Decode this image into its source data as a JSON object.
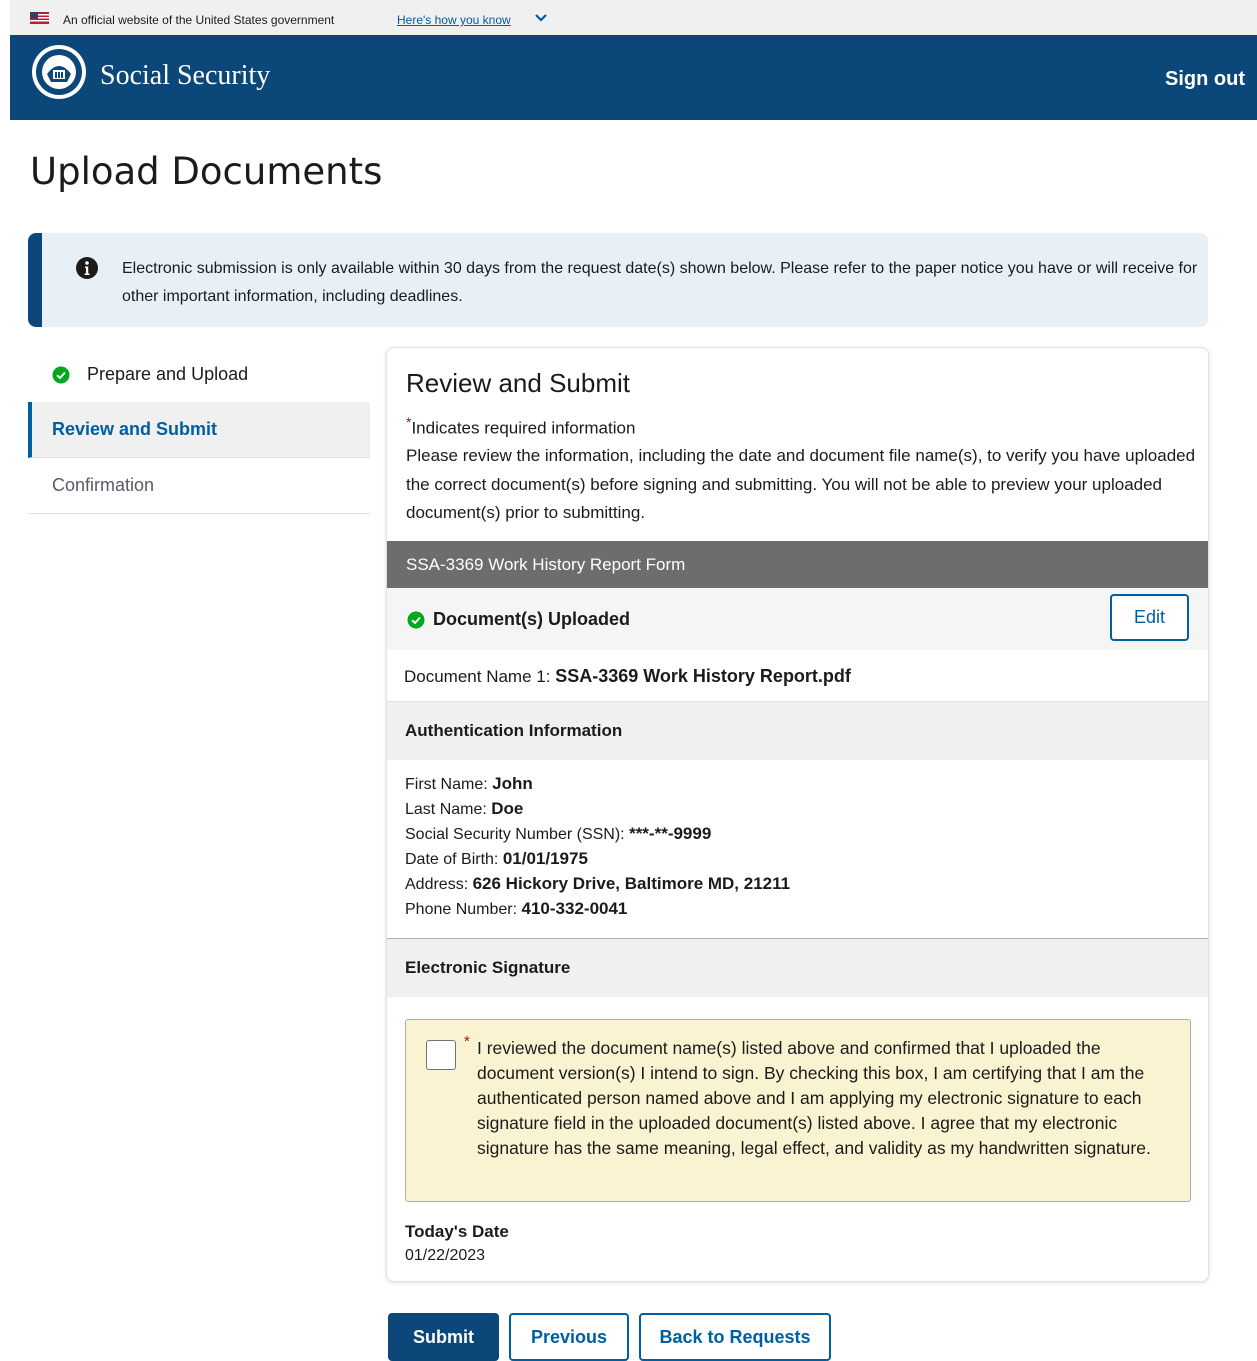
{
  "gov_banner": {
    "text": "An official website of the United States government",
    "link": "Here's how you know"
  },
  "header": {
    "brand": "Social Security",
    "sign_out": "Sign out"
  },
  "page": {
    "title": "Upload Documents"
  },
  "alert": {
    "message": "Electronic submission is only available within 30 days from the request date(s) shown below. Please refer to the paper notice you have or will receive for other important information, including deadlines."
  },
  "sidenav": {
    "items": [
      {
        "label": "Prepare and Upload",
        "status": "complete"
      },
      {
        "label": "Review and Submit",
        "status": "active"
      },
      {
        "label": "Confirmation",
        "status": "pending"
      }
    ]
  },
  "review": {
    "title": "Review and Submit",
    "required_note": "Indicates required information",
    "instructions": "Please review the information, including the date and document file name(s), to verify you have uploaded the correct document(s) before signing and submitting. You will not be able to preview your uploaded document(s) prior to submitting.",
    "form_name": "SSA-3369 Work History Report Form",
    "uploaded_status": "Document(s) Uploaded",
    "edit_label": "Edit",
    "document_name_label": "Document Name 1:",
    "document_name_value": "SSA-3369 Work History Report.pdf",
    "auth_heading": "Authentication Information",
    "auth_fields": [
      {
        "label": "First Name:",
        "value": "John"
      },
      {
        "label": "Last Name:",
        "value": "Doe"
      },
      {
        "label": "Social Security Number (SSN):",
        "value": "***-**-9999"
      },
      {
        "label": "Date of Birth:",
        "value": "01/01/1975"
      },
      {
        "label": "Address:",
        "value": "626 Hickory Drive, Baltimore MD, 21211"
      },
      {
        "label": "Phone Number:",
        "value": "410-332-0041"
      }
    ],
    "signature_heading": "Electronic Signature",
    "consent_text": "I reviewed the document name(s) listed above and confirmed that I uploaded the document version(s) I intend to sign. By checking this box, I am certifying that I am the authenticated person named above and I am applying my electronic signature to each signature field in the uploaded document(s) listed above. I agree that my electronic signature has the same meaning, legal effect, and validity as my handwritten signature.",
    "consent_checked": false,
    "date_label": "Today's Date",
    "date_value": "01/22/2023"
  },
  "actions": {
    "submit": "Submit",
    "previous": "Previous",
    "back": "Back to Requests"
  },
  "colors": {
    "header_bg": "#0b4778",
    "link": "#005ea2",
    "success": "#00a91c",
    "required": "#b50909",
    "alert_bg": "#e7f0f7",
    "consent_bg": "#faf3d1"
  }
}
